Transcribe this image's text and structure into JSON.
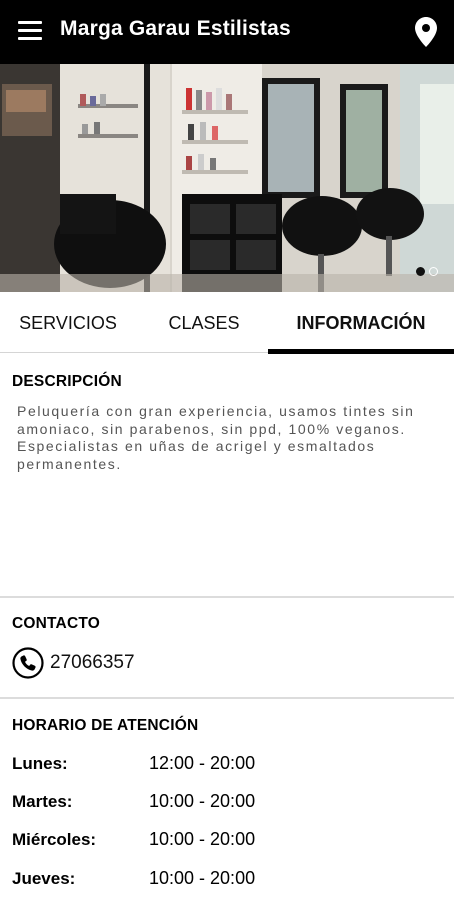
{
  "appbar": {
    "title": "Marga Garau Estilistas",
    "menu_icon": "hamburger-menu-icon",
    "location_icon": "map-pin-icon"
  },
  "hero": {
    "slides": 2,
    "active_slide": 1
  },
  "tabs": {
    "items": [
      {
        "label": "SERVICIOS",
        "active": false
      },
      {
        "label": "CLASES",
        "active": false
      },
      {
        "label": "INFORMACIÓN",
        "active": true
      }
    ]
  },
  "description": {
    "title": "DESCRIPCIÓN",
    "text": "Peluquería con gran experiencia, usamos tintes sin amoniaco, sin parabenos, sin ppd, 100% veganos. Especialistas en uñas de acrigel y esmaltados permanentes."
  },
  "contact": {
    "title": "CONTACTO",
    "phone": "27066357",
    "phone_icon": "phone-icon"
  },
  "hours": {
    "title": "HORARIO DE ATENCIÓN",
    "rows": [
      {
        "day": "Lunes:",
        "time": "12:00 - 20:00"
      },
      {
        "day": "Martes:",
        "time": "10:00 - 20:00"
      },
      {
        "day": "Miércoles:",
        "time": "10:00 - 20:00"
      },
      {
        "day": "Jueves:",
        "time": "10:00 - 20:00"
      }
    ]
  },
  "colors": {
    "appbar_bg": "#000000",
    "text_primary": "#000000",
    "text_muted": "#555555",
    "divider": "#dcdcdc"
  }
}
